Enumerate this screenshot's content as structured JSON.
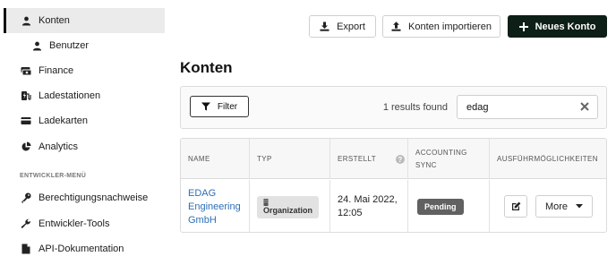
{
  "sidebar": {
    "items": [
      {
        "label": "Konten",
        "icon": "user-icon"
      },
      {
        "label": "Benutzer",
        "icon": "user-icon"
      },
      {
        "label": "Finance",
        "icon": "money-icon"
      },
      {
        "label": "Ladestationen",
        "icon": "charging-station-icon"
      },
      {
        "label": "Ladekarten",
        "icon": "credit-card-icon"
      },
      {
        "label": "Analytics",
        "icon": "pie-chart-icon"
      }
    ],
    "dev_section_label": "ENTWICKLER-MENÜ",
    "dev_items": [
      {
        "label": "Berechtigungsnachweise",
        "icon": "key-icon"
      },
      {
        "label": "Entwickler-Tools",
        "icon": "wrench-icon"
      },
      {
        "label": "API-Dokumentation",
        "icon": "document-icon"
      }
    ]
  },
  "toolbar": {
    "export_label": "Export",
    "import_label": "Konten importieren",
    "new_account_label": "Neues Konto"
  },
  "page": {
    "title": "Konten"
  },
  "filter": {
    "button_label": "Filter",
    "results_text": "1 results found",
    "search_value": "edag"
  },
  "table": {
    "headers": {
      "name": "NAME",
      "type": "TYP",
      "created": "ERSTELLT",
      "accounting_line1": "ACCOUNTING",
      "accounting_line2": "SYNC",
      "actions": "AUSFÜHRMÖGLICHKEITEN"
    },
    "rows": [
      {
        "name_line1": "EDAG",
        "name_line2": "Engineering",
        "name_line3": "GmbH",
        "type": "Organization",
        "created_line1": "24. Mai 2022,",
        "created_line2": "12:05",
        "accounting_status": "Pending",
        "more_label": "More"
      }
    ]
  },
  "colors": {
    "primary": "#0d1f17",
    "link": "#2d6fb5",
    "status_pending": "#616161",
    "sidebar_active_bg": "#ebebeb"
  }
}
